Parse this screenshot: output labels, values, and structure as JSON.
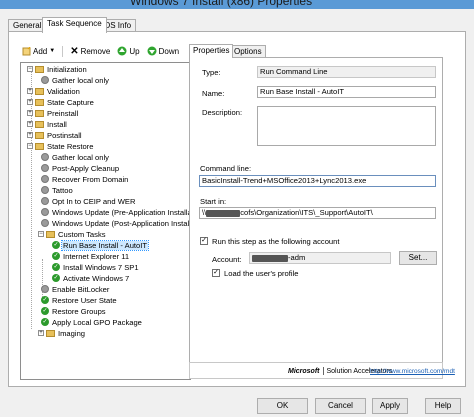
{
  "window": {
    "title": "Windows 7 Install (x86) Properties"
  },
  "outer_tabs": [
    "General",
    "Task Sequence",
    "OS Info"
  ],
  "toolbar": {
    "add": "Add",
    "remove": "Remove",
    "up": "Up",
    "down": "Down"
  },
  "tree": [
    {
      "label": "Initialization",
      "icon": "folder-icon"
    },
    {
      "label": "Gather local only",
      "icon": "gear-icon"
    },
    {
      "label": "Validation",
      "icon": "folder-icon"
    },
    {
      "label": "State Capture",
      "icon": "folder-icon"
    },
    {
      "label": "Preinstall",
      "icon": "folder-icon"
    },
    {
      "label": "Install",
      "icon": "folder-icon"
    },
    {
      "label": "Postinstall",
      "icon": "folder-icon"
    },
    {
      "label": "State Restore",
      "icon": "folder-icon"
    },
    {
      "label": "Gather local only",
      "icon": "gear-icon"
    },
    {
      "label": "Post-Apply Cleanup",
      "icon": "gear-icon"
    },
    {
      "label": "Recover From Domain",
      "icon": "gear-icon"
    },
    {
      "label": "Tattoo",
      "icon": "gear-icon"
    },
    {
      "label": "Opt In to CEIP and WER",
      "icon": "gear-icon"
    },
    {
      "label": "Windows Update (Pre-Application Installa",
      "icon": "gear-icon"
    },
    {
      "label": "Windows Update (Post-Application Installa",
      "icon": "gear-icon"
    },
    {
      "label": "Custom Tasks",
      "icon": "folder-icon"
    },
    {
      "label": "Run Base Install - AutoIT",
      "icon": "check-icon"
    },
    {
      "label": "Internet Explorer 11",
      "icon": "check-icon"
    },
    {
      "label": "Install Windows 7 SP1",
      "icon": "check-icon"
    },
    {
      "label": "Activate Windows 7",
      "icon": "check-icon"
    },
    {
      "label": "Enable BitLocker",
      "icon": "gear-icon"
    },
    {
      "label": "Restore User State",
      "icon": "check-icon"
    },
    {
      "label": "Restore Groups",
      "icon": "check-icon"
    },
    {
      "label": "Apply Local GPO Package",
      "icon": "check-icon"
    },
    {
      "label": "Imaging",
      "icon": "folder-icon"
    }
  ],
  "inner_tabs": [
    "Properties",
    "Options"
  ],
  "properties": {
    "type_label": "Type:",
    "type_value": "Run Command Line",
    "name_label": "Name:",
    "name_value": "Run Base Install - AutoIT",
    "description_label": "Description:",
    "command_line_label": "Command line:",
    "command_line_value": "BasicInstall-Trend+MSOffice2013+Lync2013.exe",
    "start_in_label": "Start in:",
    "start_in_prefix": "\\\\",
    "start_in_suffix": "cofs\\Organization\\ITS\\_Support\\AutoIT\\",
    "run_as_label": "Run this step as the following account",
    "account_label": "Account:",
    "account_suffix": "-adm",
    "set_button": "Set...",
    "load_profile_label": "Load the user's profile"
  },
  "footer": {
    "brand": "Microsoft",
    "tagline": "Solution Accelerators",
    "url": "http://www.microsoft.com/mdt"
  },
  "buttons": {
    "ok": "OK",
    "cancel": "Cancel",
    "apply": "Apply",
    "help": "Help"
  }
}
